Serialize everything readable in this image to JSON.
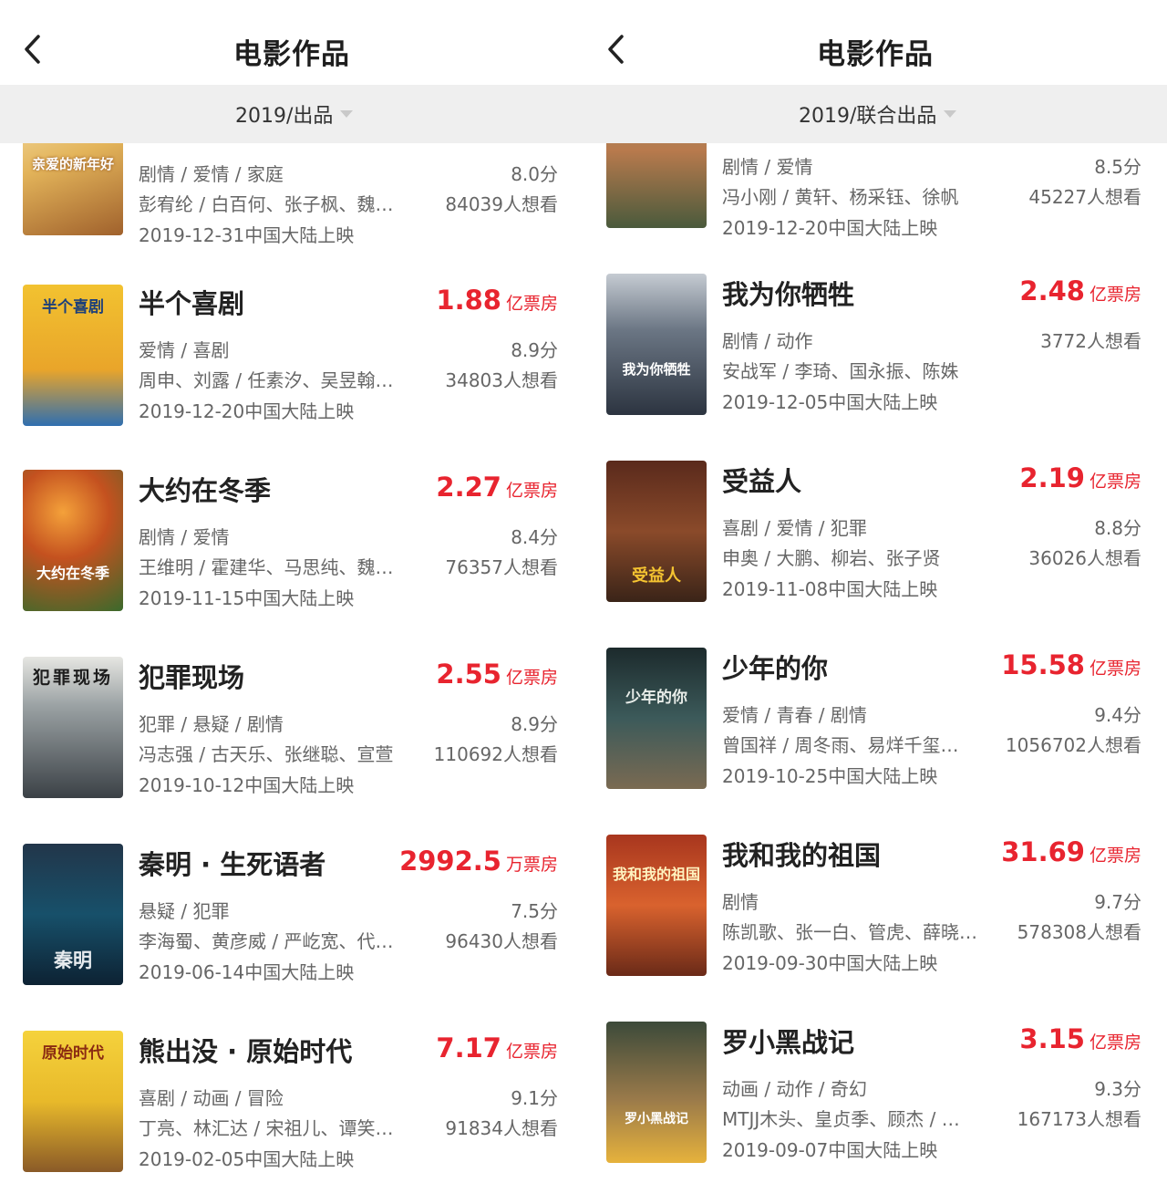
{
  "left": {
    "header": {
      "title": "电影作品"
    },
    "filter": {
      "label": "2019/出品"
    },
    "movies": [
      {
        "title": "",
        "box_num": "",
        "box_unit": "",
        "genre": "剧情 / 爱情 / 家庭",
        "score": "8.0分",
        "cast": "彭宥纶 / 白百何、张子枫、魏…",
        "want": "84039人想看",
        "release": "2019-12-31中国大陆上映",
        "poster_text": "亲爱的新年好"
      },
      {
        "title": "半个喜剧",
        "box_num": "1.88",
        "box_unit": "亿票房",
        "genre": "爱情 / 喜剧",
        "score": "8.9分",
        "cast": "周申、刘露 / 任素汐、吴昱翰…",
        "want": "34803人想看",
        "release": "2019-12-20中国大陆上映",
        "poster_text": "半个喜剧"
      },
      {
        "title": "大约在冬季",
        "box_num": "2.27",
        "box_unit": "亿票房",
        "genre": "剧情 / 爱情",
        "score": "8.4分",
        "cast": "王维明 / 霍建华、马思纯、魏…",
        "want": "76357人想看",
        "release": "2019-11-15中国大陆上映",
        "poster_text": "大约在冬季"
      },
      {
        "title": "犯罪现场",
        "box_num": "2.55",
        "box_unit": "亿票房",
        "genre": "犯罪 / 悬疑 / 剧情",
        "score": "8.9分",
        "cast": "冯志强 / 古天乐、张继聪、宣萱",
        "want": "110692人想看",
        "release": "2019-10-12中国大陆上映",
        "poster_text": "犯罪现场"
      },
      {
        "title": "秦明 · 生死语者",
        "box_num": "2992.5",
        "box_unit": "万票房",
        "genre": "悬疑 / 犯罪",
        "score": "7.5分",
        "cast": "李海蜀、黄彦威 / 严屹宽、代…",
        "want": "96430人想看",
        "release": "2019-06-14中国大陆上映",
        "poster_text": "秦明"
      },
      {
        "title": "熊出没 · 原始时代",
        "box_num": "7.17",
        "box_unit": "亿票房",
        "genre": "喜剧 / 动画 / 冒险",
        "score": "9.1分",
        "cast": "丁亮、林汇达 / 宋祖儿、谭笑…",
        "want": "91834人想看",
        "release": "2019-02-05中国大陆上映",
        "poster_text": "原始时代"
      }
    ]
  },
  "right": {
    "header": {
      "title": "电影作品"
    },
    "filter": {
      "label": "2019/联合出品"
    },
    "movies": [
      {
        "title": "",
        "box_num": "",
        "box_unit": "",
        "genre": "剧情 / 爱情",
        "score": "8.5分",
        "cast": "冯小刚 / 黄轩、杨采钰、徐帆",
        "want": "45227人想看",
        "release": "2019-12-20中国大陆上映",
        "poster_text": ""
      },
      {
        "title": "我为你牺牲",
        "box_num": "2.48",
        "box_unit": "亿票房",
        "genre": "剧情 / 动作",
        "score": "",
        "cast": "安战军 / 李琦、国永振、陈姝",
        "want": "3772人想看",
        "release": "2019-12-05中国大陆上映",
        "poster_text": "我为你牺牲"
      },
      {
        "title": "受益人",
        "box_num": "2.19",
        "box_unit": "亿票房",
        "genre": "喜剧 / 爱情 / 犯罪",
        "score": "8.8分",
        "cast": "申奥 / 大鹏、柳岩、张子贤",
        "want": "36026人想看",
        "release": "2019-11-08中国大陆上映",
        "poster_text": "受益人"
      },
      {
        "title": "少年的你",
        "box_num": "15.58",
        "box_unit": "亿票房",
        "genre": "爱情 / 青春 / 剧情",
        "score": "9.4分",
        "cast": "曾国祥 / 周冬雨、易烊千玺…",
        "want": "1056702人想看",
        "release": "2019-10-25中国大陆上映",
        "poster_text": "少年的你"
      },
      {
        "title": "我和我的祖国",
        "box_num": "31.69",
        "box_unit": "亿票房",
        "genre": "剧情",
        "score": "9.7分",
        "cast": "陈凯歌、张一白、管虎、薛晓…",
        "want": "578308人想看",
        "release": "2019-09-30中国大陆上映",
        "poster_text": "我和我的祖国"
      },
      {
        "title": "罗小黑战记",
        "box_num": "3.15",
        "box_unit": "亿票房",
        "genre": "动画 / 动作 / 奇幻",
        "score": "9.3分",
        "cast": "MTJJ木头、皇贞季、顾杰 / …",
        "want": "167173人想看",
        "release": "2019-09-07中国大陆上映",
        "poster_text": "罗小黑战记"
      }
    ]
  },
  "theme": {
    "accent": "#e8242f",
    "filter_bg": "#efefef",
    "text_secondary": "#666666"
  }
}
